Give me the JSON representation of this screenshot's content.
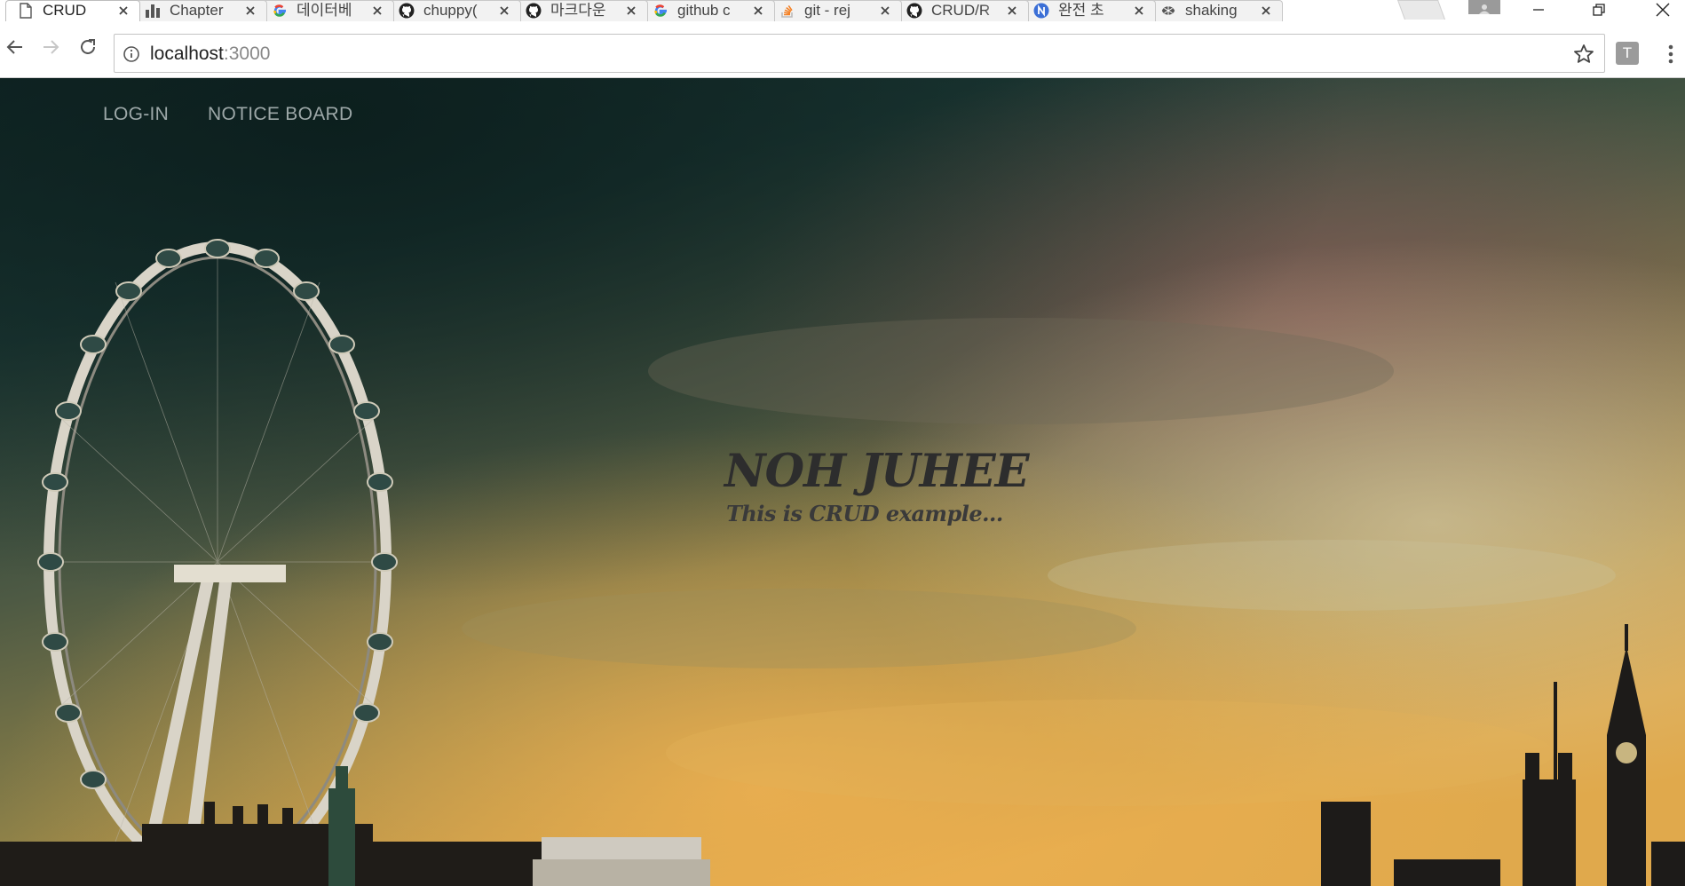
{
  "browser": {
    "tabs": [
      {
        "title": "CRUD",
        "icon": "page-icon",
        "active": true
      },
      {
        "title": "Chapter",
        "icon": "chart-icon",
        "active": false
      },
      {
        "title": "데이터베",
        "icon": "google-icon",
        "active": false
      },
      {
        "title": "chuppy(",
        "icon": "github-icon",
        "active": false
      },
      {
        "title": "마크다운",
        "icon": "github-icon",
        "active": false
      },
      {
        "title": "github c",
        "icon": "google-icon",
        "active": false
      },
      {
        "title": "git - rej",
        "icon": "stackoverflow-icon",
        "active": false
      },
      {
        "title": "CRUD/R",
        "icon": "github-icon",
        "active": false
      },
      {
        "title": "완전 초",
        "icon": "naver-icon",
        "active": false
      },
      {
        "title": "shaking",
        "icon": "logo-icon",
        "active": false
      }
    ],
    "address": {
      "host": "localhost",
      "port": ":3000"
    },
    "extension_label": "T"
  },
  "page": {
    "nav": {
      "login": "LOG-IN",
      "notice_board": "NOTICE BOARD"
    },
    "hero": {
      "title": "NOH JUHEE",
      "subtitle": "This is CRUD example..."
    }
  },
  "colors": {
    "nav_text": "#9da8a8",
    "hero_text": "#2d2d2d",
    "sky_dark": "#16302c",
    "sky_warm": "#d9a24a"
  }
}
